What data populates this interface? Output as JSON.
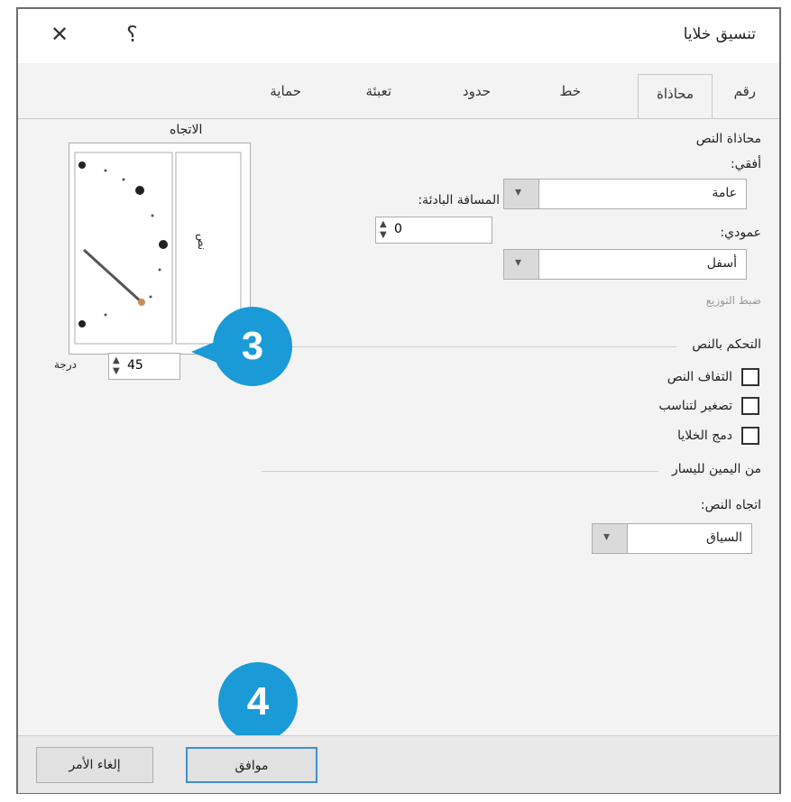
{
  "dialog": {
    "title": "تنسيق خلايا",
    "close_glyph": "✕",
    "help_glyph": "؟"
  },
  "tabs": [
    {
      "label": "رقم"
    },
    {
      "label": "محاذاة"
    },
    {
      "label": "خط"
    },
    {
      "label": "حدود"
    },
    {
      "label": "تعبئة"
    },
    {
      "label": "حماية"
    }
  ],
  "text_alignment": {
    "section": "محاذاة النص",
    "horizontal_label": "أفقي:",
    "horizontal_value": "عامة",
    "vertical_label": "عمودي:",
    "vertical_value": "أسفل",
    "indent_label": "المسافة البادئة:",
    "indent_value": "0",
    "justify_distributed": "ضبط التوزيع"
  },
  "text_control": {
    "section": "التحكم بالنص",
    "options": [
      {
        "label": "التفاف النص",
        "checked": false
      },
      {
        "label": "تصغير لتناسب",
        "checked": false
      },
      {
        "label": "دمج الخلايا",
        "checked": false
      }
    ]
  },
  "rtl": {
    "section": "من اليمين لليسار",
    "direction_label": "اتجاه النص:",
    "direction_value": "السياق"
  },
  "orientation": {
    "section": "الاتجاه",
    "vertical_text": "نص",
    "degrees_value": "45",
    "degrees_label": "درجة"
  },
  "callouts": {
    "step3": "3",
    "step4": "4"
  },
  "buttons": {
    "ok": "موافق",
    "cancel": "إلغاء الأمر"
  },
  "colors": {
    "accent": "#1a9ad6",
    "focus_border": "#3f8fd2"
  }
}
